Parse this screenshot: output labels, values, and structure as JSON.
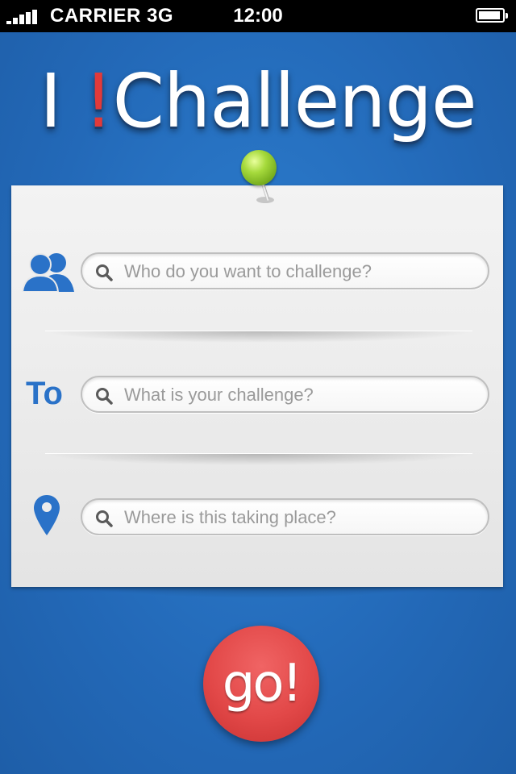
{
  "status_bar": {
    "carrier": "CARRIER 3G",
    "time": "12:00"
  },
  "app": {
    "title_prefix": "I ",
    "title_bang": "!",
    "title_suffix": "Challenge"
  },
  "form": {
    "who_placeholder": "Who do you want to challenge?",
    "to_label": "To",
    "challenge_placeholder": "What is your challenge?",
    "where_placeholder": "Where is this taking place?"
  },
  "go_button": {
    "label": "go!"
  },
  "colors": {
    "background": "#2369b8",
    "accent_blue": "#2a72c8",
    "go_red": "#e24848",
    "pin_green": "#a6da3c",
    "bang_red": "#e23a3a"
  }
}
